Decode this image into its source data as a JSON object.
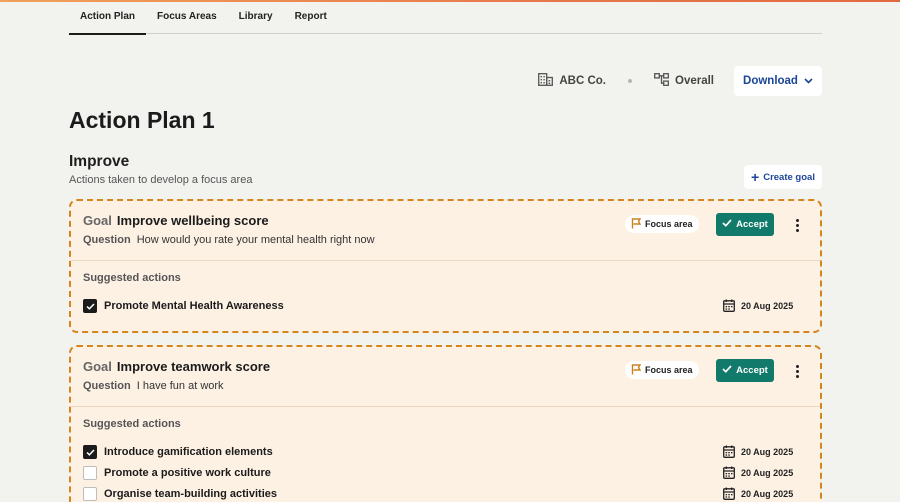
{
  "colors": {
    "accent_blue": "#1c4597",
    "accept_green": "#127a6a",
    "card_bg": "#fdf1e4",
    "card_border": "#d4851e"
  },
  "tabs": [
    {
      "label": "Action Plan",
      "active": true
    },
    {
      "label": "Focus Areas",
      "active": false
    },
    {
      "label": "Library",
      "active": false
    },
    {
      "label": "Report",
      "active": false
    }
  ],
  "meta": {
    "company": "ABC Co.",
    "scope": "Overall",
    "download_label": "Download",
    "company_icon": "building-icon",
    "scope_icon": "hierarchy-icon"
  },
  "page_title": "Action Plan 1",
  "section": {
    "title": "Improve",
    "subtitle": "Actions taken to develop a focus area",
    "create_label": "Create goal"
  },
  "goals": [
    {
      "goal_kw": "Goal",
      "title": "Improve wellbeing score",
      "question_kw": "Question",
      "question": "How would you rate your mental health right now",
      "focus_label": "Focus area",
      "accept_label": "Accept",
      "actions_title": "Suggested actions",
      "actions": [
        {
          "label": "Promote Mental Health Awareness",
          "date": "20 Aug 2025",
          "checked": true
        }
      ]
    },
    {
      "goal_kw": "Goal",
      "title": "Improve teamwork score",
      "question_kw": "Question",
      "question": "I have fun at work",
      "focus_label": "Focus area",
      "accept_label": "Accept",
      "actions_title": "Suggested actions",
      "actions": [
        {
          "label": "Introduce gamification elements",
          "date": "20 Aug 2025",
          "checked": true
        },
        {
          "label": "Promote a positive work culture",
          "date": "20 Aug 2025",
          "checked": false
        },
        {
          "label": "Organise team-building activities",
          "date": "20 Aug 2025",
          "checked": false
        }
      ]
    }
  ]
}
